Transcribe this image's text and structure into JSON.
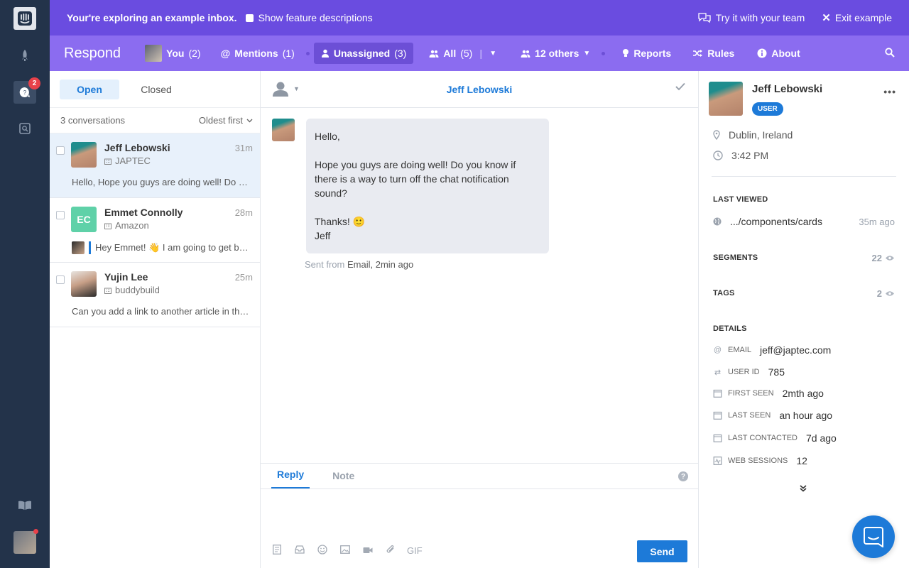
{
  "banner": {
    "message": "Your're exploring an example inbox.",
    "checkbox_label": "Show feature descriptions",
    "try_label": "Try it with your team",
    "exit_label": "Exit example"
  },
  "rail": {
    "inbox_badge": "2"
  },
  "nav": {
    "brand": "Respond",
    "you": "You",
    "you_count": "(2)",
    "mentions": "Mentions",
    "mentions_count": "(1)",
    "unassigned": "Unassigned",
    "unassigned_count": "(3)",
    "all": "All",
    "all_count": "(5)",
    "others": "12 others",
    "reports": "Reports",
    "rules": "Rules",
    "about": "About"
  },
  "list": {
    "tab_open": "Open",
    "tab_closed": "Closed",
    "count": "3 conversations",
    "sort": "Oldest first",
    "conversations": [
      {
        "name": "Jeff Lebowski",
        "company": "JAPTEC",
        "time": "31m",
        "preview": "Hello, Hope you guys are doing well! Do you know if there is a way to turn off the chat notification sound?"
      },
      {
        "name": "Emmet Connolly",
        "initials": "EC",
        "company": "Amazon",
        "time": "28m",
        "preview": "Hey Emmet! 👋 I am going to get back to you shortly"
      },
      {
        "name": "Yujin Lee",
        "company": "buddybuild",
        "time": "25m",
        "preview": "Can you add a link to another article in the help center?"
      }
    ]
  },
  "conversation": {
    "title": "Jeff Lebowski",
    "message": {
      "p1": "Hello,",
      "p2": "Hope you guys are doing well! Do you know if there is a way to turn off the chat notification sound?",
      "p3a": "Thanks! 🙂",
      "p3b": "Jeff"
    },
    "meta_prefix": "Sent from",
    "meta_channel": "Email, 2min ago"
  },
  "composer": {
    "tab_reply": "Reply",
    "tab_note": "Note",
    "help": "?",
    "gif": "GIF",
    "send": "Send"
  },
  "profile": {
    "name": "Jeff Lebowski",
    "badge": "USER",
    "location": "Dublin, Ireland",
    "local_time": "3:42 PM",
    "last_viewed_heading": "LAST VIEWED",
    "last_viewed_page": ".../components/cards",
    "last_viewed_time": "35m ago",
    "segments_heading": "SEGMENTS",
    "segments_count": "22",
    "tags_heading": "TAGS",
    "tags_count": "2",
    "details_heading": "DETAILS",
    "details": [
      {
        "label": "EMAIL",
        "value": "jeff@japtec.com"
      },
      {
        "label": "USER ID",
        "value": "785"
      },
      {
        "label": "FIRST SEEN",
        "value": "2mth ago"
      },
      {
        "label": "LAST SEEN",
        "value": "an hour ago"
      },
      {
        "label": "LAST CONTACTED",
        "value": "7d ago"
      },
      {
        "label": "WEB SESSIONS",
        "value": "12"
      }
    ]
  },
  "colors": {
    "banner": "#6a4ce0",
    "nav": "#8b6cf0",
    "accent": "#1d7ad8",
    "rail": "#23334a"
  }
}
